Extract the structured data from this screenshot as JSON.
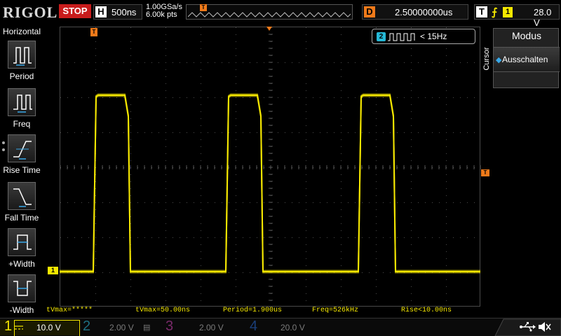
{
  "brand": {
    "logo_text": "RIGOL"
  },
  "run_state": {
    "label": "STOP",
    "color": "#c81c1c"
  },
  "horizontal": {
    "key": "H",
    "timebase": "500ns"
  },
  "acquisition": {
    "sample_rate": "1.00GSa/s",
    "memory_depth": "6.00k pts"
  },
  "delay": {
    "key": "D",
    "value": "2.50000000us"
  },
  "trigger": {
    "key": "T",
    "edge_icon": "rising-edge-icon",
    "source": "1",
    "level": "28.0 V"
  },
  "left_menu": {
    "title": "Horizontal",
    "items": [
      {
        "label": "Period",
        "icon": "period-icon"
      },
      {
        "label": "Freq",
        "icon": "freq-icon"
      },
      {
        "label": "Rise Time",
        "icon": "rise-time-icon"
      },
      {
        "label": "Fall Time",
        "icon": "fall-time-icon"
      },
      {
        "label": "+Width",
        "icon": "pos-width-icon"
      },
      {
        "label": "-Width",
        "icon": "neg-width-icon"
      }
    ]
  },
  "right_panel": {
    "tab_label": "Cursor",
    "title": "Modus",
    "mode_value": "Ausschalten"
  },
  "freq_counter": {
    "channel": "2",
    "value": "< 15Hz",
    "color": "#25b8d6"
  },
  "markers": {
    "trigger_position": "T",
    "trigger_level": "T",
    "ch1_ground": "1"
  },
  "measurements": [
    {
      "text": "tVmax=*****"
    },
    {
      "text": "tVmax=50.00ns"
    },
    {
      "text": "Period=1.900us"
    },
    {
      "text": "Freq=526kHz"
    },
    {
      "text": "Rise<10.00ns"
    }
  ],
  "channels": [
    {
      "num": "1",
      "scale": "10.0 V",
      "color": "#f5e800",
      "active": true
    },
    {
      "num": "2",
      "scale": "2.00 V",
      "color": "#1e6e80",
      "active": false
    },
    {
      "num": "3",
      "scale": "2.00 V",
      "color": "#7a2a6a",
      "active": false
    },
    {
      "num": "4",
      "scale": "20.0 V",
      "color": "#1a3f7a",
      "active": false
    }
  ],
  "status_icons": [
    "usb-icon",
    "speaker-mute-icon"
  ],
  "trace": {
    "color": "#f5e800",
    "high_level_fraction": 0.245,
    "low_level_fraction": 0.875,
    "pulse_starts_fraction": [
      0.085,
      0.4,
      0.715
    ],
    "pulse_width_fraction": 0.08
  }
}
